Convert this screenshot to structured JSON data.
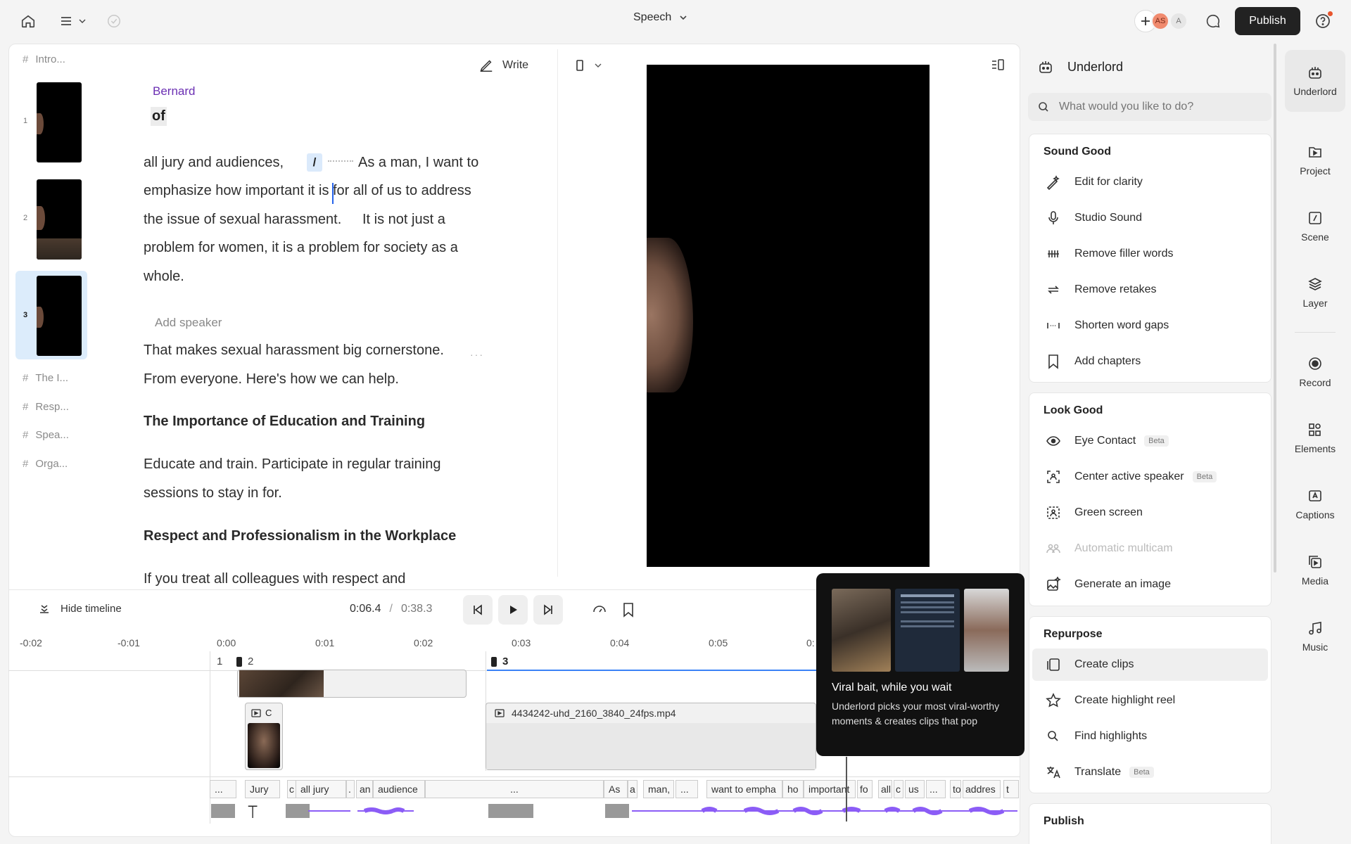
{
  "topbar": {
    "title": "Speech",
    "publish": "Publish",
    "avatar1": "AS",
    "avatar2": "A"
  },
  "editor": {
    "toc": [
      {
        "id": "intro",
        "label": "Intro..."
      },
      {
        "id": "the",
        "label": "The I..."
      },
      {
        "id": "resp",
        "label": "Resp..."
      },
      {
        "id": "spea",
        "label": "Spea..."
      },
      {
        "id": "orga",
        "label": "Orga..."
      }
    ],
    "thumb_numbers": [
      "1",
      "2",
      "3"
    ],
    "write": "Write",
    "speaker": "Bernard",
    "word_of": "of",
    "para1": [
      "all jury and audiences,",
      "/",
      "As a man, I want to",
      "emphasize how important it is for all of us to address",
      "the issue of sexual harassment.",
      "It is not just a",
      "problem for women, it is a problem for society as a",
      "whole."
    ],
    "add_speaker": "Add speaker",
    "para2": [
      "That makes sexual harassment big cornerstone.",
      "From everyone. Here's how we can help."
    ],
    "heading1": "The Importance of Education and Training",
    "para3": [
      "Educate and train. Participate in regular training",
      "sessions to stay in for."
    ],
    "heading2": "Respect and Professionalism in the Workplace",
    "para4": "If you treat all colleagues with respect and"
  },
  "timeline": {
    "hide": "Hide timeline",
    "current": "0:06.4",
    "sep": "/",
    "total": "0:38.3",
    "ticks": [
      "-0:02",
      "-0:01",
      "0:00",
      "0:01",
      "0:02",
      "0:03",
      "0:04",
      "0:05",
      "0:"
    ],
    "scene_labels": [
      "1",
      "2",
      "3"
    ],
    "clip_c": "C",
    "file": "4434242-uhd_2160_3840_24fps.mp4",
    "words": [
      "...",
      "Jury",
      "c",
      "all jury",
      ".",
      "an",
      "audience",
      "...",
      "As",
      "a",
      "man,",
      "...",
      "want to empha",
      "ho",
      "important",
      "fo",
      "all",
      "c",
      "us",
      "...",
      "to",
      "addres",
      "t"
    ]
  },
  "tooltip": {
    "title": "Viral bait, while you wait",
    "body": "Underlord picks your most viral-worthy moments & creates clips that pop"
  },
  "underlord": {
    "title": "Underlord",
    "search_placeholder": "What would you like to do?",
    "sound_good": {
      "title": "Sound Good",
      "items": [
        "Edit for clarity",
        "Studio Sound",
        "Remove filler words",
        "Remove retakes",
        "Shorten word gaps",
        "Add chapters"
      ]
    },
    "look_good": {
      "title": "Look Good",
      "items": [
        "Eye Contact",
        "Center active speaker",
        "Green screen",
        "Automatic multicam",
        "Generate an image"
      ],
      "beta": "Beta"
    },
    "repurpose": {
      "title": "Repurpose",
      "items": [
        "Create clips",
        "Create highlight reel",
        "Find highlights",
        "Translate"
      ],
      "beta": "Beta"
    },
    "publish": {
      "title": "Publish"
    }
  },
  "sidebar": [
    "Underlord",
    "Project",
    "Scene",
    "Layer",
    "Record",
    "Elements",
    "Captions",
    "Media",
    "Music"
  ]
}
